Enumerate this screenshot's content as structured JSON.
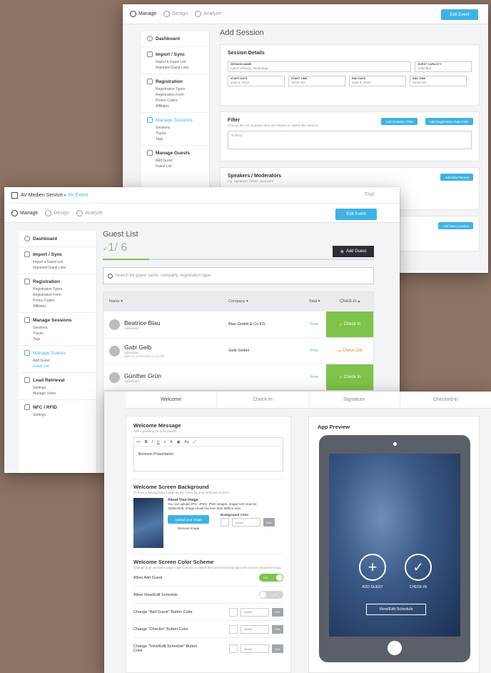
{
  "back_window": {
    "nav": {
      "manage": "Manage",
      "design": "Design",
      "analyze": "Analyze",
      "edit_event": "Edit Event"
    },
    "sidebar": {
      "dashboard": "Dashboard",
      "import_sync": "Import / Sync",
      "import_items": [
        "Import a Guest List",
        "Imported Guest Lists"
      ],
      "registration": "Registration",
      "registration_items": [
        "Registration Types",
        "Registration Form",
        "Promo Codes",
        "Affiliates"
      ],
      "manage_sessions": "Manage Sessions",
      "session_items": [
        "Sessions",
        "Tracks",
        "Tags"
      ],
      "manage_guests": "Manage Guests",
      "guest_items": [
        "Add Guest",
        "Guest List"
      ]
    },
    "page_title": "Add Session",
    "session_details": {
      "title": "Session Details",
      "session_name_label": "SESSION NAME",
      "session_name_value": "Lunch Session, Workshop",
      "guest_capacity_label": "GUEST CAPACITY",
      "guest_capacity_value": "Unlimited",
      "start_date_label": "START DATE",
      "start_date_value": "June 5, 2016",
      "start_time_label": "START TIME",
      "start_time_value": "10:00 AM",
      "end_date_label": "END DATE",
      "end_date_value": "June 5, 2016",
      "end_time_label": "END TIME",
      "end_time_value": "03:00 AM"
    },
    "filter": {
      "title": "Filter",
      "desc": "Choose the set of guests who are allowed to attend this session",
      "btn_invitation": "Add Invitation Filter",
      "btn_registration": "Add Registration Type Filter",
      "textarea": "Nothing"
    },
    "speakers": {
      "title": "Speakers / Moderators",
      "desc": "e.g. Speakers, Artists, Sponsors",
      "btn": "Add New Person"
    },
    "location_btn": "Add New Location"
  },
  "mid_window": {
    "title": {
      "company": "AV-Medien Service",
      "breadcrumb": "Ihr Event",
      "trial": "Trial"
    },
    "nav": {
      "manage": "Manage",
      "design": "Design",
      "analyze": "Analyze",
      "edit_event": "Edit Event"
    },
    "sidebar": {
      "dashboard": "Dashboard",
      "import_sync": "Import / Sync",
      "import_items": [
        "Import a Guest List",
        "Imported Guest Lists"
      ],
      "registration": "Registration",
      "registration_items": [
        "Registration Types",
        "Registration Form",
        "Promo Codes",
        "Affiliates"
      ],
      "manage_sessions": "Manage Sessions",
      "session_items": [
        "Sessions",
        "Tracks",
        "Tags"
      ],
      "manage_guests": "Manage Guests",
      "guest_items": [
        "Add Guest",
        "Guest List"
      ],
      "lead_retrieval": "Lead Retrieval",
      "lead_items": [
        "Settings",
        "Manage Users"
      ],
      "nfc_rfid": "NFC / RFID",
      "nfc_items": [
        "Settings"
      ]
    },
    "page_title": "Guest List",
    "checked_in": "1",
    "total": "/ 6",
    "progress": 0.17,
    "add_guest": "Add Guest",
    "search_placeholder": "Search for guest name, company, registration type",
    "table": {
      "headers": {
        "name": "Name",
        "company": "Company",
        "total": "Total",
        "checkin": "Check-in"
      },
      "rows": [
        {
          "name": "Beatrice Blau",
          "type": "Admission",
          "tag": "",
          "company": "Blau GmbH & Co KG",
          "total": "Free",
          "action": "Check In",
          "state": "in"
        },
        {
          "name": "Gabi Gelb",
          "type": "Admission",
          "tag": "WED 01:10 PM   WED 01:15 PM",
          "company": "Gelb GmbH",
          "total": "Free",
          "action": "Check Out",
          "state": "out"
        },
        {
          "name": "Günther Grün",
          "type": "Admission",
          "tag": "",
          "company": "",
          "total": "Free",
          "action": "Check In",
          "state": "in"
        }
      ]
    }
  },
  "front_window": {
    "steps": [
      "Welcome",
      "Check-in",
      "Signature",
      "Checked-in"
    ],
    "welcome_message": {
      "title": "Welcome Message",
      "desc": "Add a greeting for your guests.",
      "toolbar": [
        "<>",
        "B",
        "I",
        "U",
        "≡",
        "A",
        "▣",
        "Aa",
        "⤢"
      ],
      "body": "Boomset Präsentation"
    },
    "background": {
      "title": "Welcome Screen Background",
      "desc": "Choose a background image as the cover for your welcome screen.",
      "about_title": "About Your Image",
      "about_text": "You can upload JPG, JPEG, PNG images. Image size must be 1536x2048. Image should be less than 5MB in size.",
      "upload_btn": "Upload your image",
      "remove": "Remove image",
      "bg_color_label": "Background Color",
      "bg_color_value": "#####",
      "edit": "Edit"
    },
    "color_scheme": {
      "title": "Welcome Screen Color Scheme",
      "desc": "Change your welcome page color scheme to match the customized background or your company's logo",
      "allow_add_guest": "Allow Add Guest",
      "allow_add_guest_state": "ON",
      "allow_view_schedule": "Allow View/Edit Schedule",
      "allow_view_schedule_state": "OFF",
      "color_rows": [
        {
          "label": "Change \"Add Guest\" Button Color",
          "value": "#####",
          "edit": "Edit"
        },
        {
          "label": "Change \"Checkin\" Button Color",
          "value": "#####",
          "edit": "Edit"
        },
        {
          "label": "Change \"View/Edit Schedule\" Button Color",
          "value": "#####",
          "edit": "Edit"
        }
      ]
    },
    "preview": {
      "title": "App Preview",
      "add_guest": "ADD GUEST",
      "check_in": "CHECK-IN",
      "schedule_btn": "View/Edit Schedule"
    }
  },
  "colors": {
    "accent_blue": "#3fb2e5",
    "success_green": "#7ec34b",
    "checkout_orange": "#f07c2b",
    "backdrop": "#8c7262"
  },
  "icons": [
    "manage-icon",
    "design-icon",
    "analyze-icon",
    "dashboard-icon",
    "import-icon",
    "registration-icon",
    "sessions-icon",
    "guests-icon",
    "lead-icon",
    "nfc-icon",
    "search-icon",
    "plus-icon",
    "check-icon"
  ]
}
